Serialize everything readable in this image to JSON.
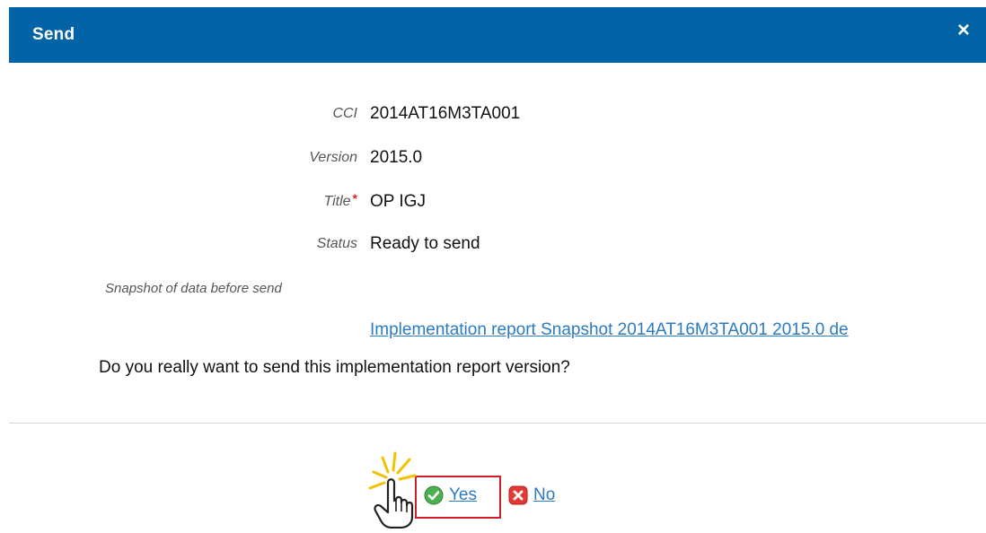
{
  "dialog": {
    "title": "Send",
    "close_glyph": "×"
  },
  "fields": {
    "cci": {
      "label": "CCI",
      "value": "2014AT16M3TA001"
    },
    "version": {
      "label": "Version",
      "value": "2015.0"
    },
    "title": {
      "label": "Title",
      "required_mark": "*",
      "value": "OP IGJ"
    },
    "status": {
      "label": "Status",
      "value": "Ready to send"
    }
  },
  "snapshot": {
    "label": "Snapshot of data before send",
    "link": "Implementation report Snapshot 2014AT16M3TA001 2015.0 de"
  },
  "question": "Do you really want to send this implementation report version?",
  "actions": {
    "yes_label": "Yes",
    "no_label": "No"
  },
  "icons": {
    "yes": "check-circle-icon",
    "no": "x-square-icon",
    "cursor": "hand-pointer-icon"
  },
  "colors": {
    "header": "#0263a6",
    "link": "#2a7bc0",
    "highlight": "#cc1f2a",
    "yes_icon": "#4caf50",
    "no_icon": "#e53935"
  }
}
